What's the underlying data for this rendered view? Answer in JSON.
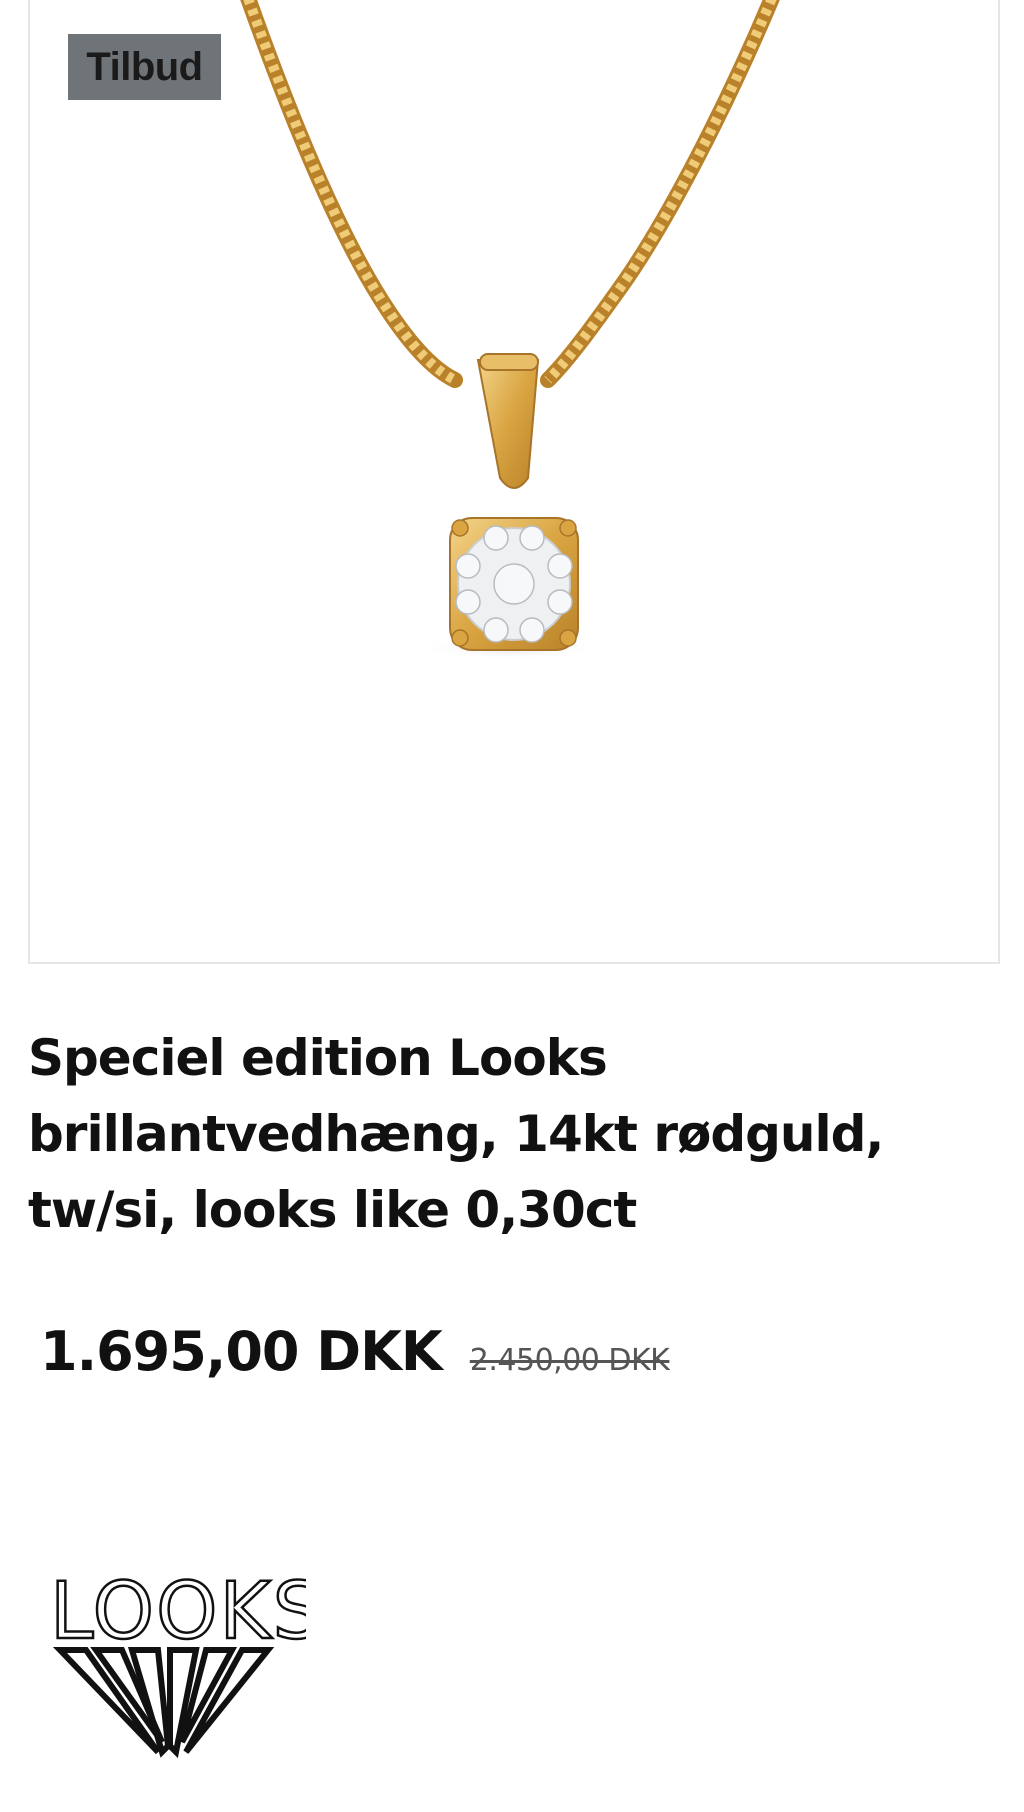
{
  "product": {
    "badge": "Tilbud",
    "image_icon": "necklace-pendant-image",
    "title": "Speciel edition Looks brillantvedhæng, 14kt rødguld, tw/si, looks like 0,30ct",
    "price_current": "1.695,00 DKK",
    "price_old": "2.450,00 DKK"
  },
  "brand": {
    "logo_text": "LOOKS",
    "logo_icon": "diamond-logo-icon"
  },
  "colors": {
    "badge_bg": "#6f7478",
    "gold": "#d9a441",
    "text": "#111111"
  }
}
